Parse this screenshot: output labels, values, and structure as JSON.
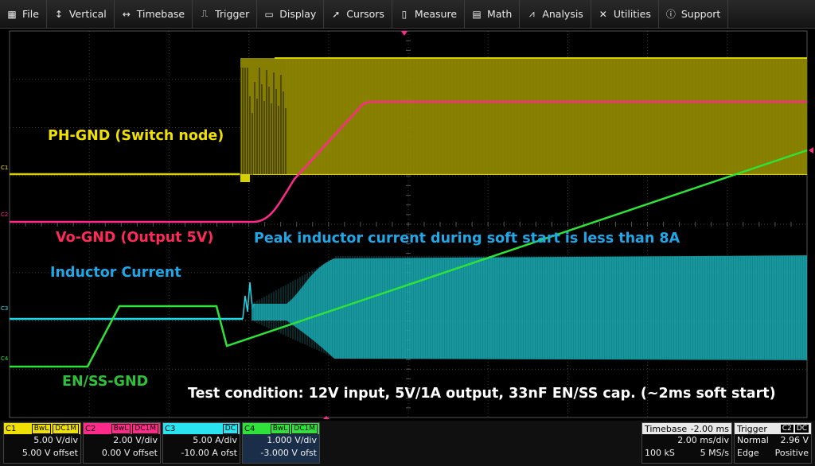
{
  "menu": [
    {
      "label": "File",
      "icon": "file-icon",
      "glyph": "▦"
    },
    {
      "label": "Vertical",
      "icon": "vertical-arrows-icon",
      "glyph": "↕"
    },
    {
      "label": "Timebase",
      "icon": "horizontal-arrows-icon",
      "glyph": "↔"
    },
    {
      "label": "Trigger",
      "icon": "trigger-icon",
      "glyph": "⎍"
    },
    {
      "label": "Display",
      "icon": "display-icon",
      "glyph": "▭"
    },
    {
      "label": "Cursors",
      "icon": "cursor-icon",
      "glyph": "➚"
    },
    {
      "label": "Measure",
      "icon": "measure-icon",
      "glyph": "▯"
    },
    {
      "label": "Math",
      "icon": "calculator-icon",
      "glyph": "▤"
    },
    {
      "label": "Analysis",
      "icon": "analysis-chart-icon",
      "glyph": "⩘"
    },
    {
      "label": "Utilities",
      "icon": "wrench-icon",
      "glyph": "✕"
    },
    {
      "label": "Support",
      "icon": "info-icon",
      "glyph": "ⓘ"
    }
  ],
  "annotations": {
    "ph": "PH-GND (Switch node)",
    "vo": "Vo-GND (Output 5V)",
    "peak": "Peak inductor current during soft start is less than 8A",
    "inductor": "Inductor Current",
    "enss": "EN/SS-GND",
    "test": "Test condition: 12V input, 5V/1A output, 33nF EN/SS cap. (~2ms soft start)"
  },
  "markers": {
    "c1": "C1",
    "c2": "C2",
    "c3": "C3",
    "c4": "C4"
  },
  "channels": [
    {
      "name": "C1",
      "color": "#f0e000",
      "tags": [
        "BwL",
        "DC1M"
      ],
      "vdiv": "5.00 V/div",
      "offset": "5.00 V offset"
    },
    {
      "name": "C2",
      "color": "#ff2a8a",
      "tags": [
        "BwL",
        "DC1M"
      ],
      "vdiv": "2.00 V/div",
      "offset": "0.00 V offset"
    },
    {
      "name": "C3",
      "color": "#29e3f0",
      "tags": [
        "DC"
      ],
      "vdiv": "5.00 A/div",
      "offset": "-10.00 A ofst"
    },
    {
      "name": "C4",
      "color": "#2ee23a",
      "tags": [
        "BwL",
        "DC1M"
      ],
      "vdiv": "1.000 V/div",
      "offset": "-3.000 V ofst"
    }
  ],
  "timebase": {
    "title": "Timebase",
    "delay": "-2.00 ms",
    "div": "2.00 ms/div",
    "samples": "100 kS",
    "rate": "5 MS/s"
  },
  "trigger": {
    "title": "Trigger",
    "source": "C2",
    "coupling": "DC",
    "mode": "Normal",
    "level": "2.96 V",
    "type": "Edge",
    "slope": "Positive"
  },
  "colors": {
    "ch1": "#d6d000",
    "ch2": "#ff2a8a",
    "ch3": "#1fd8e8",
    "ch4": "#2ee23a",
    "grid": "#444"
  }
}
